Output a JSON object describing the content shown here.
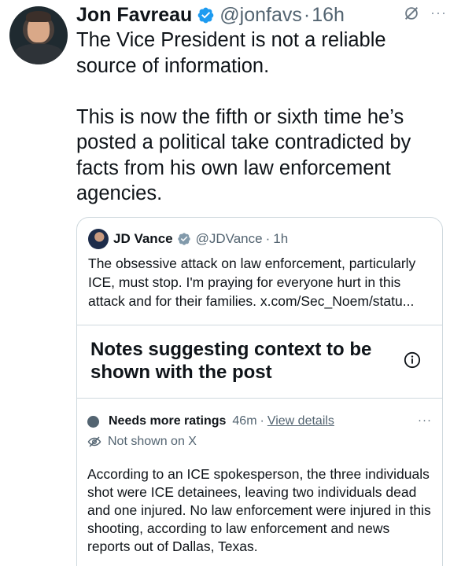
{
  "tweet": {
    "author_name": "Jon Favreau",
    "handle": "@jonfavs",
    "separator": "·",
    "time": "16h",
    "text": "The Vice President is not a reliable source of information.\n\nThis is now the fifth or sixth time he’s posted a political take contradicted by facts from his own law enforcement agencies."
  },
  "quoted": {
    "author_name": "JD Vance",
    "handle": "@JDVance",
    "separator": "·",
    "time": "1h",
    "text": "The obsessive attack on law enforcement, particularly ICE, must stop. I'm praying for everyone hurt in this attack and for their families. x.com/Sec_Noem/statu..."
  },
  "community_note": {
    "title": "Notes suggesting context to be shown with the post",
    "status_label": "Needs more ratings",
    "status_time": "46m",
    "separator": "·",
    "view_details": "View details",
    "visibility": "Not shown on X",
    "body": "According to an ICE spokesperson, the three individuals shot were ICE detainees, leaving two individuals dead and one injured. No law enforcement were injured in this shooting, according to law enforcement and news reports out of Dallas, Texas."
  },
  "icons": {
    "verified": "verified-badge-icon",
    "grok": "grok-icon",
    "more": "more-icon",
    "info": "info-icon",
    "eye_off": "eye-off-icon"
  },
  "colors": {
    "verified_blue": "#1d9bf0",
    "secondary_text": "#536471",
    "border": "#cfd9de"
  },
  "more_glyph": "···"
}
